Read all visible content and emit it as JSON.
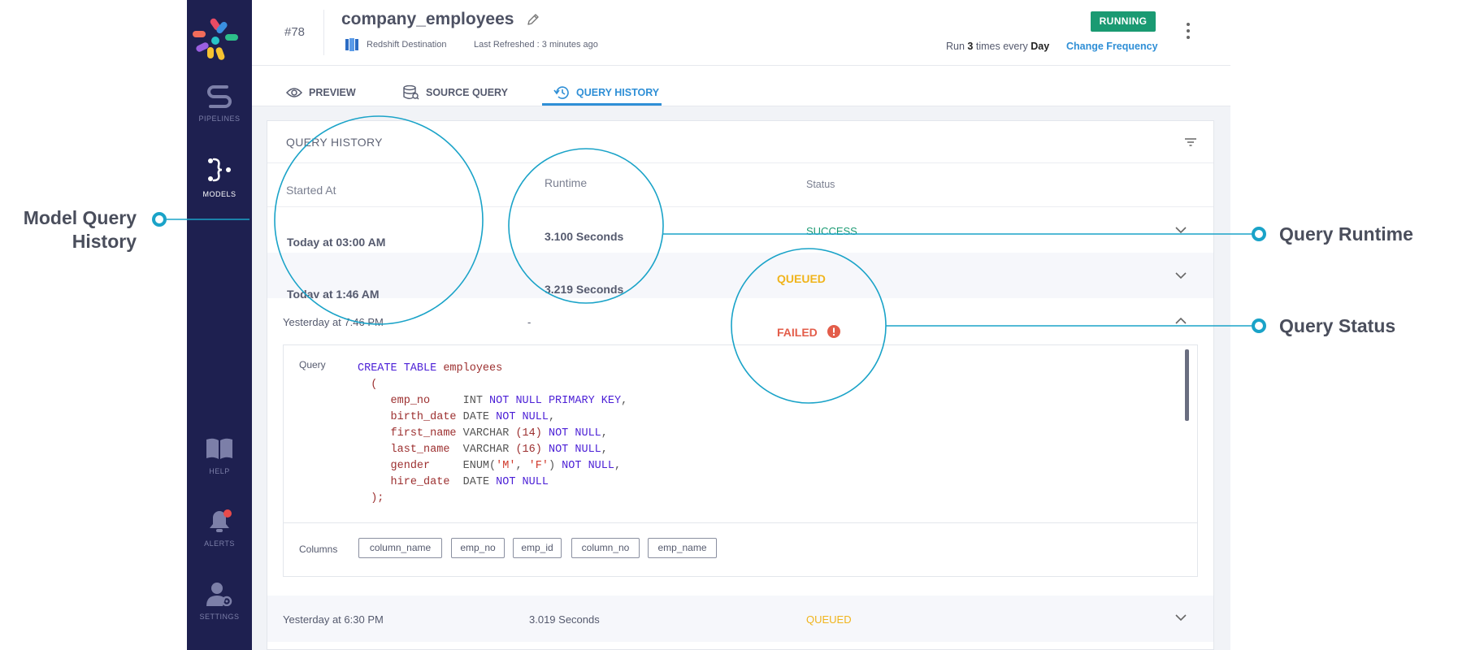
{
  "sidebar": {
    "items": [
      {
        "label": "PIPELINES",
        "icon": "pipelines-icon"
      },
      {
        "label": "MODELS",
        "icon": "models-icon",
        "active": true
      },
      {
        "label": "HELP",
        "icon": "book-icon"
      },
      {
        "label": "ALERTS",
        "icon": "bell-icon"
      },
      {
        "label": "SETTINGS",
        "icon": "user-gear-icon"
      }
    ]
  },
  "header": {
    "id": "#78",
    "title": "company_employees",
    "destination": "Redshift Destination",
    "last_refreshed": "Last Refreshed : 3 minutes ago",
    "status": "RUNNING",
    "frequency": {
      "prefix": "Run",
      "count": "3",
      "middle": "times every",
      "unit": "Day"
    },
    "change_frequency": "Change Frequency"
  },
  "tabs": [
    {
      "label": "PREVIEW",
      "icon": "eye-icon"
    },
    {
      "label": "SOURCE QUERY",
      "icon": "database-search-icon"
    },
    {
      "label": "QUERY HISTORY",
      "icon": "history-icon",
      "active": true
    }
  ],
  "history": {
    "title": "QUERY HISTORY",
    "columns": {
      "started_at": "Started At",
      "runtime": "Runtime",
      "status": "Status"
    },
    "rows": [
      {
        "started_at": "Today at 03:00 AM",
        "runtime": "3.100 Seconds",
        "status": "SUCCESS"
      },
      {
        "started_at": "Today at 1:46 AM",
        "runtime": "3.219 Seconds",
        "status": "QUEUED"
      },
      {
        "started_at": "Yesterday at 7:46 PM",
        "runtime": "-",
        "status": "FAILED"
      },
      {
        "started_at": "Yesterday at 6:30 PM",
        "runtime": "3.019 Seconds",
        "status": "QUEUED"
      }
    ],
    "detail": {
      "query_label": "Query",
      "columns_label": "Columns",
      "column_chips": [
        "column_name",
        "emp_no",
        "emp_id",
        "column_no",
        "emp_name"
      ]
    }
  },
  "callouts": {
    "history": [
      "Model Query",
      "History"
    ],
    "runtime": "Query Runtime",
    "status": "Query Status"
  },
  "colors": {
    "sidebar": "#1e2050",
    "accent": "#2f8fd6",
    "success": "#1a9a72",
    "queued": "#f0b41c",
    "failed": "#e35d4a",
    "callout": "#1aa3c8"
  }
}
